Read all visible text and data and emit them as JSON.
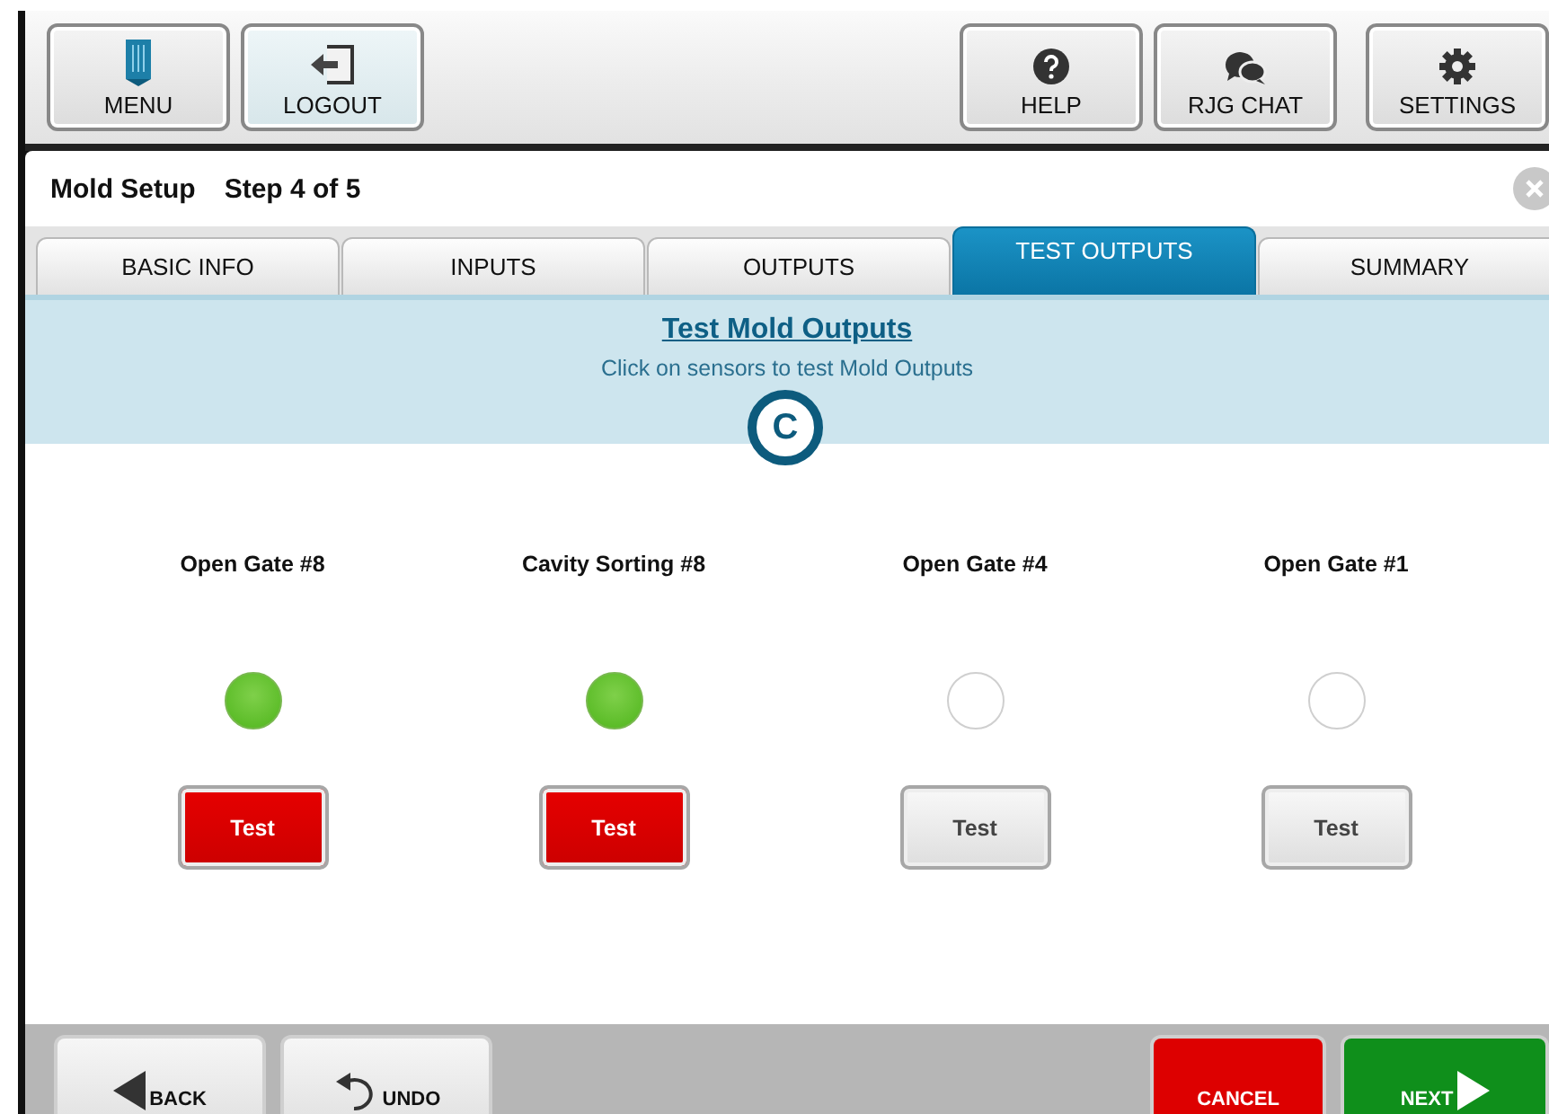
{
  "toolbar": {
    "left": [
      {
        "kind": "menu",
        "label": "MENU"
      },
      {
        "kind": "logout",
        "label": "LOGOUT"
      }
    ],
    "right": [
      {
        "kind": "help",
        "label": "HELP"
      },
      {
        "kind": "chat",
        "label": "RJG CHAT"
      },
      {
        "kind": "settings",
        "label": "SETTINGS"
      }
    ]
  },
  "header": {
    "title": "Mold Setup",
    "step": "Step 4 of 5"
  },
  "tabs": [
    {
      "label": "BASIC INFO",
      "selected": false
    },
    {
      "label": "INPUTS",
      "selected": false
    },
    {
      "label": "OUTPUTS",
      "selected": false
    },
    {
      "label": "TEST OUTPUTS",
      "selected": true
    },
    {
      "label": "SUMMARY",
      "selected": false
    }
  ],
  "banner": {
    "title": "Test Mold Outputs",
    "subtitle": "Click on sensors to test Mold Outputs",
    "callout": "C"
  },
  "outputs": [
    {
      "name": "Open Gate #8",
      "on": true,
      "button": "Test"
    },
    {
      "name": "Cavity Sorting #8",
      "on": true,
      "button": "Test"
    },
    {
      "name": "Open Gate #4",
      "on": false,
      "button": "Test"
    },
    {
      "name": "Open Gate #1",
      "on": false,
      "button": "Test"
    }
  ],
  "footer": {
    "left": [
      {
        "kind": "back",
        "label": "BACK"
      },
      {
        "kind": "undo",
        "label": "UNDO"
      }
    ],
    "right": [
      {
        "kind": "cancel",
        "label": "CANCEL"
      },
      {
        "kind": "next",
        "label": "NEXT"
      }
    ]
  }
}
